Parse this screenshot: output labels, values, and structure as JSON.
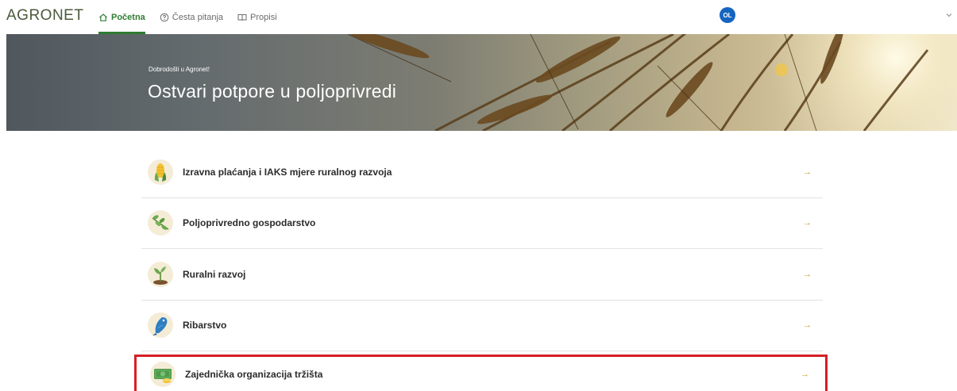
{
  "header": {
    "logo": "AGRONET",
    "nav": [
      {
        "label": "Početna",
        "icon": "home-icon",
        "active": true
      },
      {
        "label": "Česta pitanja",
        "icon": "question-circle-icon",
        "active": false
      },
      {
        "label": "Propisi",
        "icon": "book-icon",
        "active": false
      }
    ],
    "user_initials": "OL",
    "user_menu_icon": "chevron-down-icon"
  },
  "hero": {
    "subtitle": "Dobrodošli u Agronet!",
    "title": "Ostvari potpore u poljoprivredi"
  },
  "categories": [
    {
      "label": "Izravna plaćanja i IAKS mjere ruralnog razvoja",
      "icon": "corn-icon",
      "arrow": "→"
    },
    {
      "label": "Poljoprivredno gospodarstvo",
      "icon": "leaves-icon",
      "arrow": "→"
    },
    {
      "label": "Ruralni razvoj",
      "icon": "sprout-icon",
      "arrow": "→"
    },
    {
      "label": "Ribarstvo",
      "icon": "fish-icon",
      "arrow": "→"
    },
    {
      "label": "Zajednička organizacija tržišta",
      "icon": "money-icon",
      "arrow": "→",
      "highlighted": true
    }
  ],
  "colors": {
    "brand_green": "#2f7d32",
    "avatar_blue": "#1565c0",
    "arrow_gold": "#c69b2c",
    "highlight_red": "#d61f26"
  }
}
